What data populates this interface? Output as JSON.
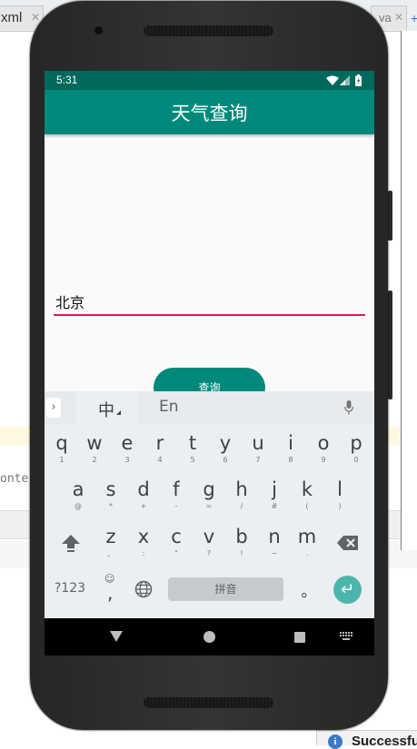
{
  "ide": {
    "tabs": [
      {
        "label": "xml",
        "close": "✕"
      },
      {
        "label": "va",
        "close": "✕"
      }
    ],
    "side_text": "onte",
    "new_tab": "+",
    "toast_text": "Successfu",
    "toast_icon": "i"
  },
  "status_bar": {
    "time": "5:31"
  },
  "app": {
    "title": "天气查询",
    "city_value": "北京",
    "query_button": "查询",
    "accent_color": "#00897b",
    "status_color": "#00695c",
    "underline_color": "#d81b60"
  },
  "keyboard": {
    "expand_icon": "›",
    "mode_chinese": "中",
    "mode_english": "En",
    "row1": [
      {
        "main": "q",
        "sub": "1"
      },
      {
        "main": "w",
        "sub": "2"
      },
      {
        "main": "e",
        "sub": "3"
      },
      {
        "main": "r",
        "sub": "4"
      },
      {
        "main": "t",
        "sub": "5"
      },
      {
        "main": "y",
        "sub": "6"
      },
      {
        "main": "u",
        "sub": "7"
      },
      {
        "main": "i",
        "sub": "8"
      },
      {
        "main": "o",
        "sub": "9"
      },
      {
        "main": "p",
        "sub": "0"
      }
    ],
    "row2": [
      {
        "main": "a",
        "sub": "@"
      },
      {
        "main": "s",
        "sub": "*"
      },
      {
        "main": "d",
        "sub": "+"
      },
      {
        "main": "f",
        "sub": "-"
      },
      {
        "main": "g",
        "sub": "="
      },
      {
        "main": "h",
        "sub": "/"
      },
      {
        "main": "j",
        "sub": "#"
      },
      {
        "main": "k",
        "sub": "("
      },
      {
        "main": "l",
        "sub": ")"
      }
    ],
    "row3": [
      {
        "main": "z",
        "sub": "、"
      },
      {
        "main": "x",
        "sub": ":"
      },
      {
        "main": "c",
        "sub": "\""
      },
      {
        "main": "v",
        "sub": "?"
      },
      {
        "main": "b",
        "sub": "!"
      },
      {
        "main": "n",
        "sub": "~"
      },
      {
        "main": "m",
        "sub": "."
      }
    ],
    "symbols_key": "?123",
    "emoji_key_top": "☺",
    "emoji_key_bottom": ",",
    "space_label": "拼音",
    "period_key": "。",
    "enter_icon": "↵"
  }
}
